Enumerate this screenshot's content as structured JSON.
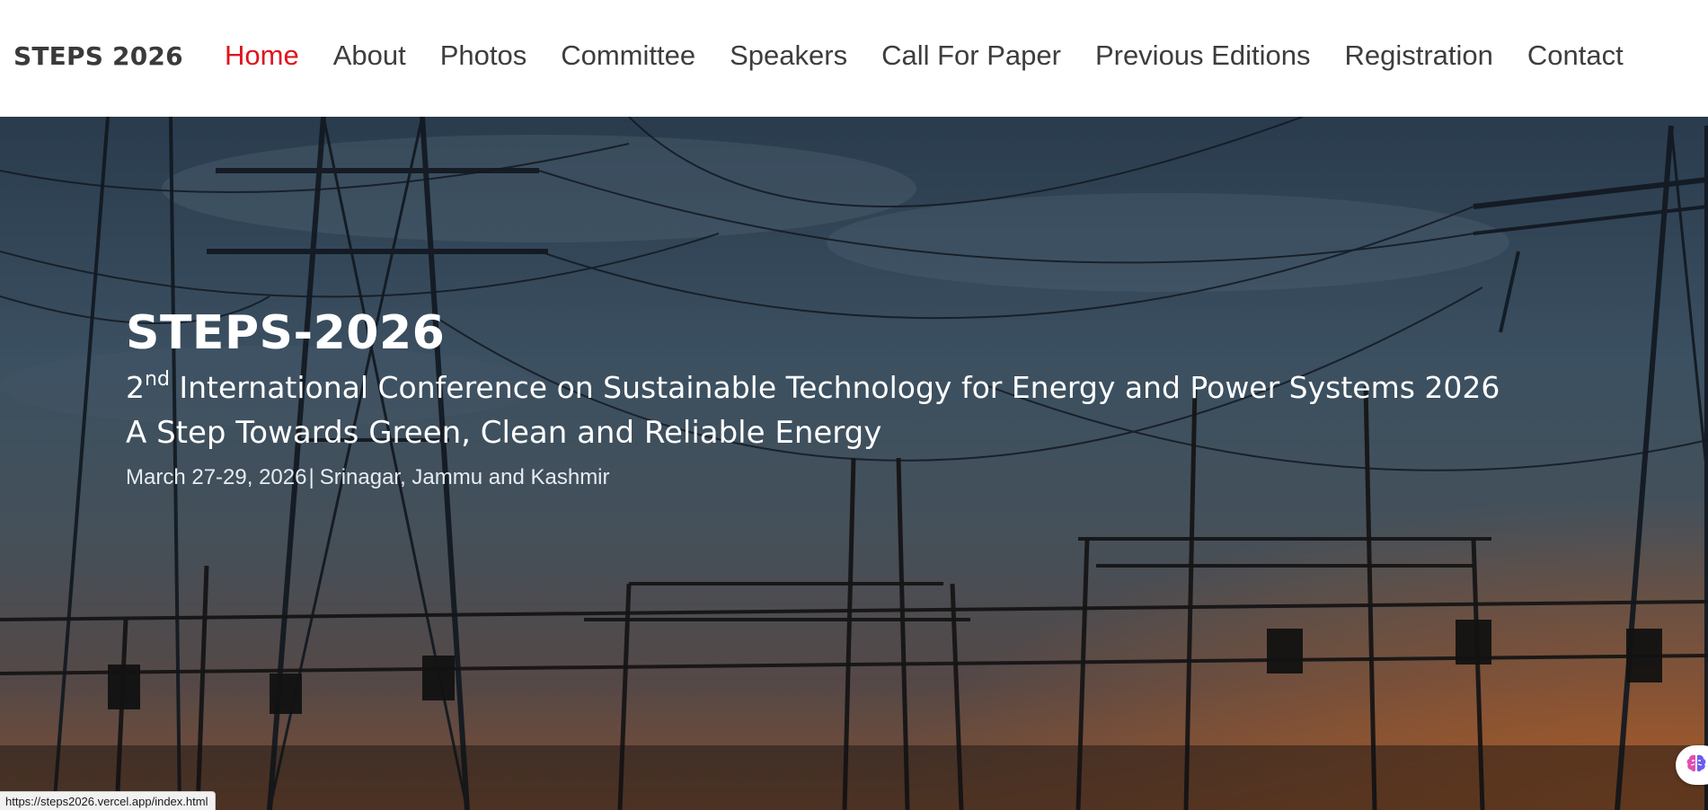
{
  "brand": "STEPS 2026",
  "nav": {
    "items": [
      {
        "label": "Home",
        "active": true
      },
      {
        "label": "About"
      },
      {
        "label": "Photos"
      },
      {
        "label": "Committee"
      },
      {
        "label": "Speakers"
      },
      {
        "label": "Call For Paper"
      },
      {
        "label": "Previous Editions"
      },
      {
        "label": "Registration"
      },
      {
        "label": "Contact"
      }
    ],
    "active_color": "#e0141e"
  },
  "hero": {
    "title": "STEPS-2026",
    "subtitle_ordinal": "2",
    "subtitle_suffix": "nd",
    "subtitle_rest": " International Conference on Sustainable Technology for Energy and Power Systems 2026",
    "tagline": "A Step Towards Green, Clean and Reliable Energy",
    "date": "March 27-29, 2026",
    "separator": "|",
    "location": "Srinagar, Jammu and Kashmir",
    "background_icon": "power-lines-image"
  },
  "status_bar": {
    "url": "https://steps2026.vercel.app/index.html"
  },
  "assistant": {
    "icon": "brain-icon"
  }
}
